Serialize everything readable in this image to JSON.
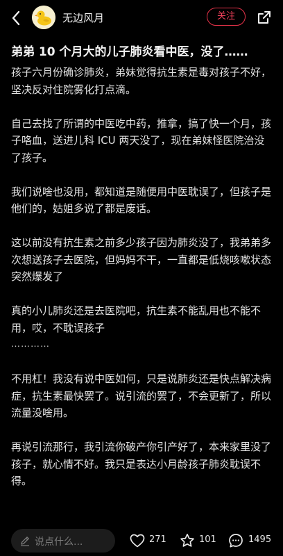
{
  "header": {
    "author_name": "无边风月",
    "follow_label": "关注"
  },
  "post": {
    "title": "弟弟 10 个月大的儿子肺炎看中医，没了……",
    "paragraphs": [
      "孩子六月份确诊肺炎，弟妹觉得抗生素是毒对孩子不好，坚决反对住院雾化打点滴。",
      "自己去找了所谓的中医吃中药，推拿，搞了快一个月，孩子咯血，送进儿科 ICU 两天没了，现在弟妹怪医院治没了孩子。",
      "我们说啥也没用，都知道是随便用中医耽误了，但孩子是他们的，姑姐多说了都是废话。",
      "这以前没有抗生素之前多少孩子因为肺炎没了，我弟弟多次想送孩子去医院，但妈妈不干，一直都是低烧咳嗽状态突然爆发了",
      "真的小儿肺炎还是去医院吧，抗生素不能乱用也不能不用，哎，不耽误孩子",
      "…………",
      "不用杠！我没有说中医如何，只是说肺炎还是快点解决病症，抗生素最快罢了。说引流的罢了，不会更新了，所以流量没啥用。",
      "再说引流那行，我引流你破产你引产好了，本来家里没了孩子，就心情不好。我只是表达小月龄孩子肺炎耽误不得。"
    ]
  },
  "bottom_bar": {
    "comment_placeholder": "说点什么...",
    "like_count": "271",
    "favorite_count": "101",
    "comment_count": "1495"
  },
  "colors": {
    "background": "#000000",
    "accent_red": "#e8334a",
    "text": "#e2e2e2"
  },
  "icons": [
    "back-arrow-icon",
    "duck-avatar",
    "share-icon",
    "pencil-icon",
    "heart-icon",
    "star-icon",
    "comment-bubble-icon"
  ]
}
